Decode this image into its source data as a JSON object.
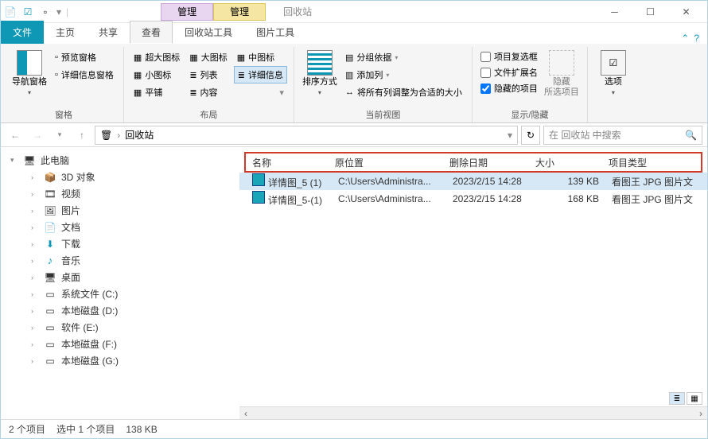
{
  "title": "回收站",
  "context_tabs": {
    "manage1": "管理",
    "manage2": "管理"
  },
  "qat": {
    "icon1": "file-icon",
    "icon2": "check-icon",
    "icon3": "folder-icon",
    "dropdown": "▾"
  },
  "tabs": {
    "file": "文件",
    "home": "主页",
    "share": "共享",
    "view": "查看",
    "recycle_tools": "回收站工具",
    "picture_tools": "图片工具"
  },
  "ribbon": {
    "panes_group": "窗格",
    "nav_pane": "导航窗格",
    "preview_pane": "预览窗格",
    "details_pane": "详细信息窗格",
    "layout_group": "布局",
    "l_xlarge": "超大图标",
    "l_large": "大图标",
    "l_medium": "中图标",
    "l_small": "小图标",
    "l_list": "列表",
    "l_details": "详细信息",
    "l_tiles": "平铺",
    "l_content": "内容",
    "currview_group": "当前视图",
    "sort": "排序方式",
    "groupby": "分组依据",
    "addcol": "添加列",
    "sizecols": "将所有列调整为合适的大小",
    "showhide_group": "显示/隐藏",
    "chk_checkbox": "项目复选框",
    "chk_ext": "文件扩展名",
    "chk_hidden": "隐藏的项目",
    "hide_sel": "隐藏\n所选项目",
    "options": "选项"
  },
  "breadcrumb": {
    "location": "回收站"
  },
  "search_placeholder": "在 回收站 中搜索",
  "tree": {
    "root": "此电脑",
    "items": [
      {
        "label": "3D 对象",
        "icon": "i-3d"
      },
      {
        "label": "视频",
        "icon": "i-video"
      },
      {
        "label": "图片",
        "icon": "i-pic"
      },
      {
        "label": "文档",
        "icon": "i-doc"
      },
      {
        "label": "下载",
        "icon": "i-download"
      },
      {
        "label": "音乐",
        "icon": "i-music"
      },
      {
        "label": "桌面",
        "icon": "i-desktop"
      },
      {
        "label": "系统文件 (C:)",
        "icon": "i-disk"
      },
      {
        "label": "本地磁盘 (D:)",
        "icon": "i-disk"
      },
      {
        "label": "软件 (E:)",
        "icon": "i-disk"
      },
      {
        "label": "本地磁盘 (F:)",
        "icon": "i-disk"
      },
      {
        "label": "本地磁盘 (G:)",
        "icon": "i-disk"
      }
    ]
  },
  "columns": {
    "name": "名称",
    "orig": "原位置",
    "deleted": "删除日期",
    "size": "大小",
    "type": "项目类型"
  },
  "rows": [
    {
      "name": "详情图_5 (1)",
      "orig": "C:\\Users\\Administra...",
      "deleted": "2023/2/15 14:28",
      "size": "139 KB",
      "type": "看图王 JPG 图片文",
      "selected": true
    },
    {
      "name": "详情图_5-(1)",
      "orig": "C:\\Users\\Administra...",
      "deleted": "2023/2/15 14:28",
      "size": "168 KB",
      "type": "看图王 JPG 图片文",
      "selected": false
    }
  ],
  "status": {
    "items": "2 个项目",
    "selected": "选中 1 个项目",
    "size": "138 KB"
  }
}
